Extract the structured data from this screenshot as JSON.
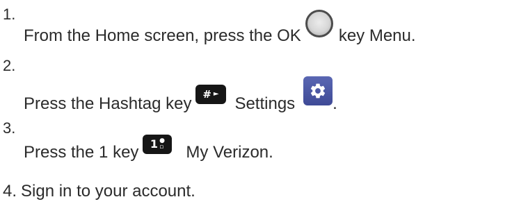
{
  "steps": [
    {
      "number": "1.",
      "text_before": "From the Home screen, press the OK",
      "icon": "ok-key-icon",
      "text_after": "key Menu."
    },
    {
      "number": "2.",
      "text_before": "Press the Hashtag key",
      "icon_1": "hashtag-key-icon",
      "icon_1_label": "#",
      "text_middle": "Settings",
      "icon_2": "settings-gear-icon",
      "text_after": "."
    },
    {
      "number": "3.",
      "text_before": "Press the 1 key",
      "icon": "one-key-icon",
      "icon_label": "1",
      "text_after": "My Verizon."
    },
    {
      "number": "4.",
      "text": "Sign in to your account."
    }
  ],
  "colors": {
    "text": "#2b2b2b",
    "key_dark": "#161616",
    "settings_blue": "#4a57a6"
  }
}
